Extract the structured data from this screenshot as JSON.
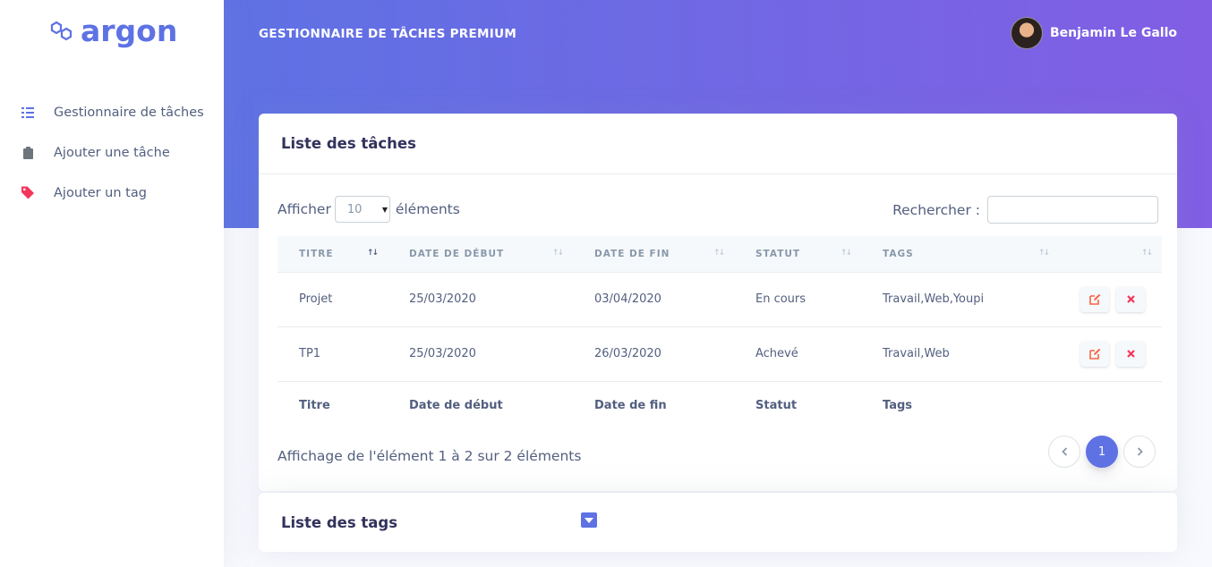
{
  "brand": {
    "name": "argon"
  },
  "sidebar": {
    "items": [
      {
        "label": "Gestionnaire de tâches",
        "icon": "list-check-icon",
        "color": "#5e72e4"
      },
      {
        "label": "Ajouter une tâche",
        "icon": "clipboard-icon",
        "color": "#6c757d"
      },
      {
        "label": "Ajouter un tag",
        "icon": "tag-icon",
        "color": "#f5365c"
      }
    ]
  },
  "header": {
    "title": "GESTIONNAIRE DE TÂCHES PREMIUM",
    "user_name": "Benjamin Le Gallo"
  },
  "tasks_card": {
    "title": "Liste des tâches",
    "show_prefix": "Afficher",
    "show_value": "10",
    "show_suffix": "éléments",
    "search_label": "Rechercher :",
    "search_value": "",
    "columns": [
      "TITRE",
      "DATE DE DÉBUT",
      "DATE DE FIN",
      "STATUT",
      "TAGS",
      ""
    ],
    "footer_columns": [
      "Titre",
      "Date de début",
      "Date de fin",
      "Statut",
      "Tags",
      ""
    ],
    "rows": [
      {
        "titre": "Projet",
        "debut": "25/03/2020",
        "fin": "03/04/2020",
        "statut": "En cours",
        "tags": "Travail,Web,Youpi"
      },
      {
        "titre": "TP1",
        "debut": "25/03/2020",
        "fin": "26/03/2020",
        "statut": "Achevé",
        "tags": "Travail,Web"
      }
    ],
    "info": "Affichage de l'élément 1 à 2 sur 2 éléments",
    "pagination": {
      "prev": "‹",
      "current": "1",
      "next": "›"
    }
  },
  "tags_card": {
    "title": "Liste des tags"
  },
  "colors": {
    "primary": "#5e72e4",
    "gradient_end": "#825ee4",
    "danger": "#f5365c",
    "edit": "#fb6340"
  }
}
